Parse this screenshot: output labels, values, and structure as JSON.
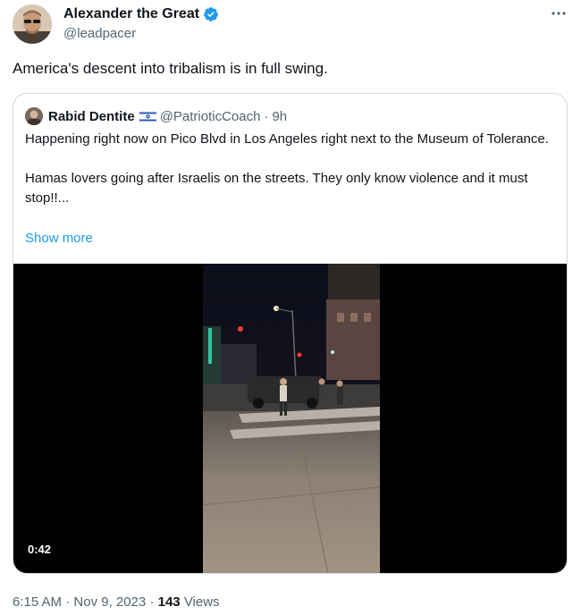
{
  "author": {
    "name": "Alexander the Great",
    "handle": "@leadpacer",
    "verified": true,
    "avatar_icon": "profile-photo"
  },
  "more_icon": "ellipsis-icon",
  "tweet": {
    "text": "America's descent into tribalism is in full swing."
  },
  "quoted_tweet": {
    "author_name": "Rabid Dentite",
    "flag_icon": "israel-flag",
    "handle": "@PatrioticCoach",
    "separator": "·",
    "time": "9h",
    "paragraphs": [
      "Happening right now on Pico Blvd in Los Angeles right next to the Museum of Tolerance.",
      "Hamas lovers going after Israelis on the streets. They only know violence and it must stop!!..."
    ],
    "show_more_label": "Show more",
    "video": {
      "duration": "0:42"
    }
  },
  "meta": {
    "time": "6:15 AM",
    "separator": "·",
    "date": "Nov 9, 2023",
    "separator2": "·",
    "views_count": "143",
    "views_label": "Views"
  },
  "colors": {
    "primary_text": "#0f1419",
    "secondary_text": "#536471",
    "link_blue": "#1d9bf0",
    "border": "#cfd9de",
    "verified_blue": "#1d9bf0"
  }
}
